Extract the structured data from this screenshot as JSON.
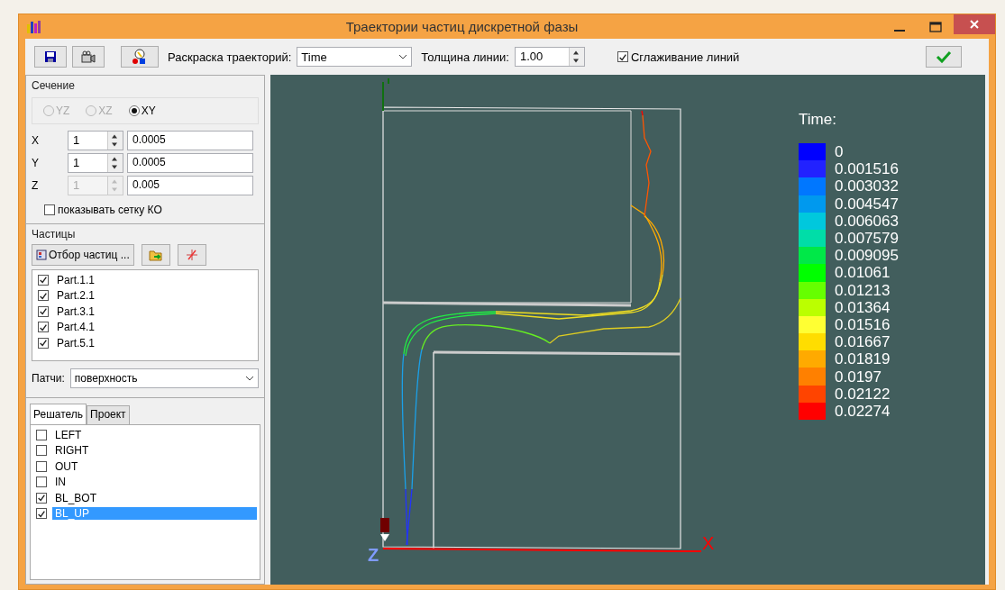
{
  "window": {
    "title": "Траектории частиц дискретной фазы"
  },
  "toolbar": {
    "color_label": "Раскраска траекторий:",
    "color_value": "Time",
    "width_label": "Толщина линии:",
    "width_value": "1.00",
    "smoothing": {
      "label": "Сглаживание линий",
      "checked": true
    }
  },
  "section": {
    "title": "Сечение",
    "planes": [
      {
        "label": "YZ",
        "selected": false,
        "disabled": true
      },
      {
        "label": "XZ",
        "selected": false,
        "disabled": true
      },
      {
        "label": "XY",
        "selected": true,
        "disabled": false
      }
    ],
    "axes": [
      {
        "label": "X",
        "index": "1",
        "value": "0.0005",
        "disabled": false
      },
      {
        "label": "Y",
        "index": "1",
        "value": "0.0005",
        "disabled": false
      },
      {
        "label": "Z",
        "index": "1",
        "value": "0.005",
        "disabled": true
      }
    ],
    "show_grid": {
      "label": "показывать сетку КО",
      "checked": false
    }
  },
  "particles": {
    "title": "Частицы",
    "select_button": "Отбор частиц ...",
    "items": [
      {
        "label": "Part.1.1",
        "checked": true
      },
      {
        "label": "Part.2.1",
        "checked": true
      },
      {
        "label": "Part.3.1",
        "checked": true
      },
      {
        "label": "Part.4.1",
        "checked": true
      },
      {
        "label": "Part.5.1",
        "checked": true
      }
    ]
  },
  "patches": {
    "label": "Патчи:",
    "value": "поверхность"
  },
  "tabs": [
    {
      "label": "Решатель",
      "selected": true
    },
    {
      "label": "Проект",
      "selected": false
    }
  ],
  "patch_list": [
    {
      "label": "LEFT",
      "checked": false,
      "selected": false
    },
    {
      "label": "RIGHT",
      "checked": false,
      "selected": false
    },
    {
      "label": "OUT",
      "checked": false,
      "selected": false
    },
    {
      "label": "IN",
      "checked": false,
      "selected": false
    },
    {
      "label": "BL_BOT",
      "checked": true,
      "selected": false
    },
    {
      "label": "BL_UP",
      "checked": true,
      "selected": true
    }
  ],
  "viewport": {
    "axis_x_label": "X",
    "axis_z_label": "Z",
    "legend": {
      "title": "Time:",
      "items": [
        {
          "label": "0",
          "color": "#0000ff"
        },
        {
          "label": "0.001516",
          "color": "#2222ff"
        },
        {
          "label": "0.003032",
          "color": "#0077ff"
        },
        {
          "label": "0.004547",
          "color": "#0099ee"
        },
        {
          "label": "0.006063",
          "color": "#00c8dd"
        },
        {
          "label": "0.007579",
          "color": "#00dda8"
        },
        {
          "label": "0.009095",
          "color": "#00e848"
        },
        {
          "label": "0.01061",
          "color": "#00ff00"
        },
        {
          "label": "0.01213",
          "color": "#66ff00"
        },
        {
          "label": "0.01364",
          "color": "#bbff00"
        },
        {
          "label": "0.01516",
          "color": "#ffff33"
        },
        {
          "label": "0.01667",
          "color": "#ffdd00"
        },
        {
          "label": "0.01819",
          "color": "#ffaa00"
        },
        {
          "label": "0.0197",
          "color": "#ff8000"
        },
        {
          "label": "0.02122",
          "color": "#ff4400"
        },
        {
          "label": "0.02274",
          "color": "#ff0000"
        }
      ]
    }
  }
}
